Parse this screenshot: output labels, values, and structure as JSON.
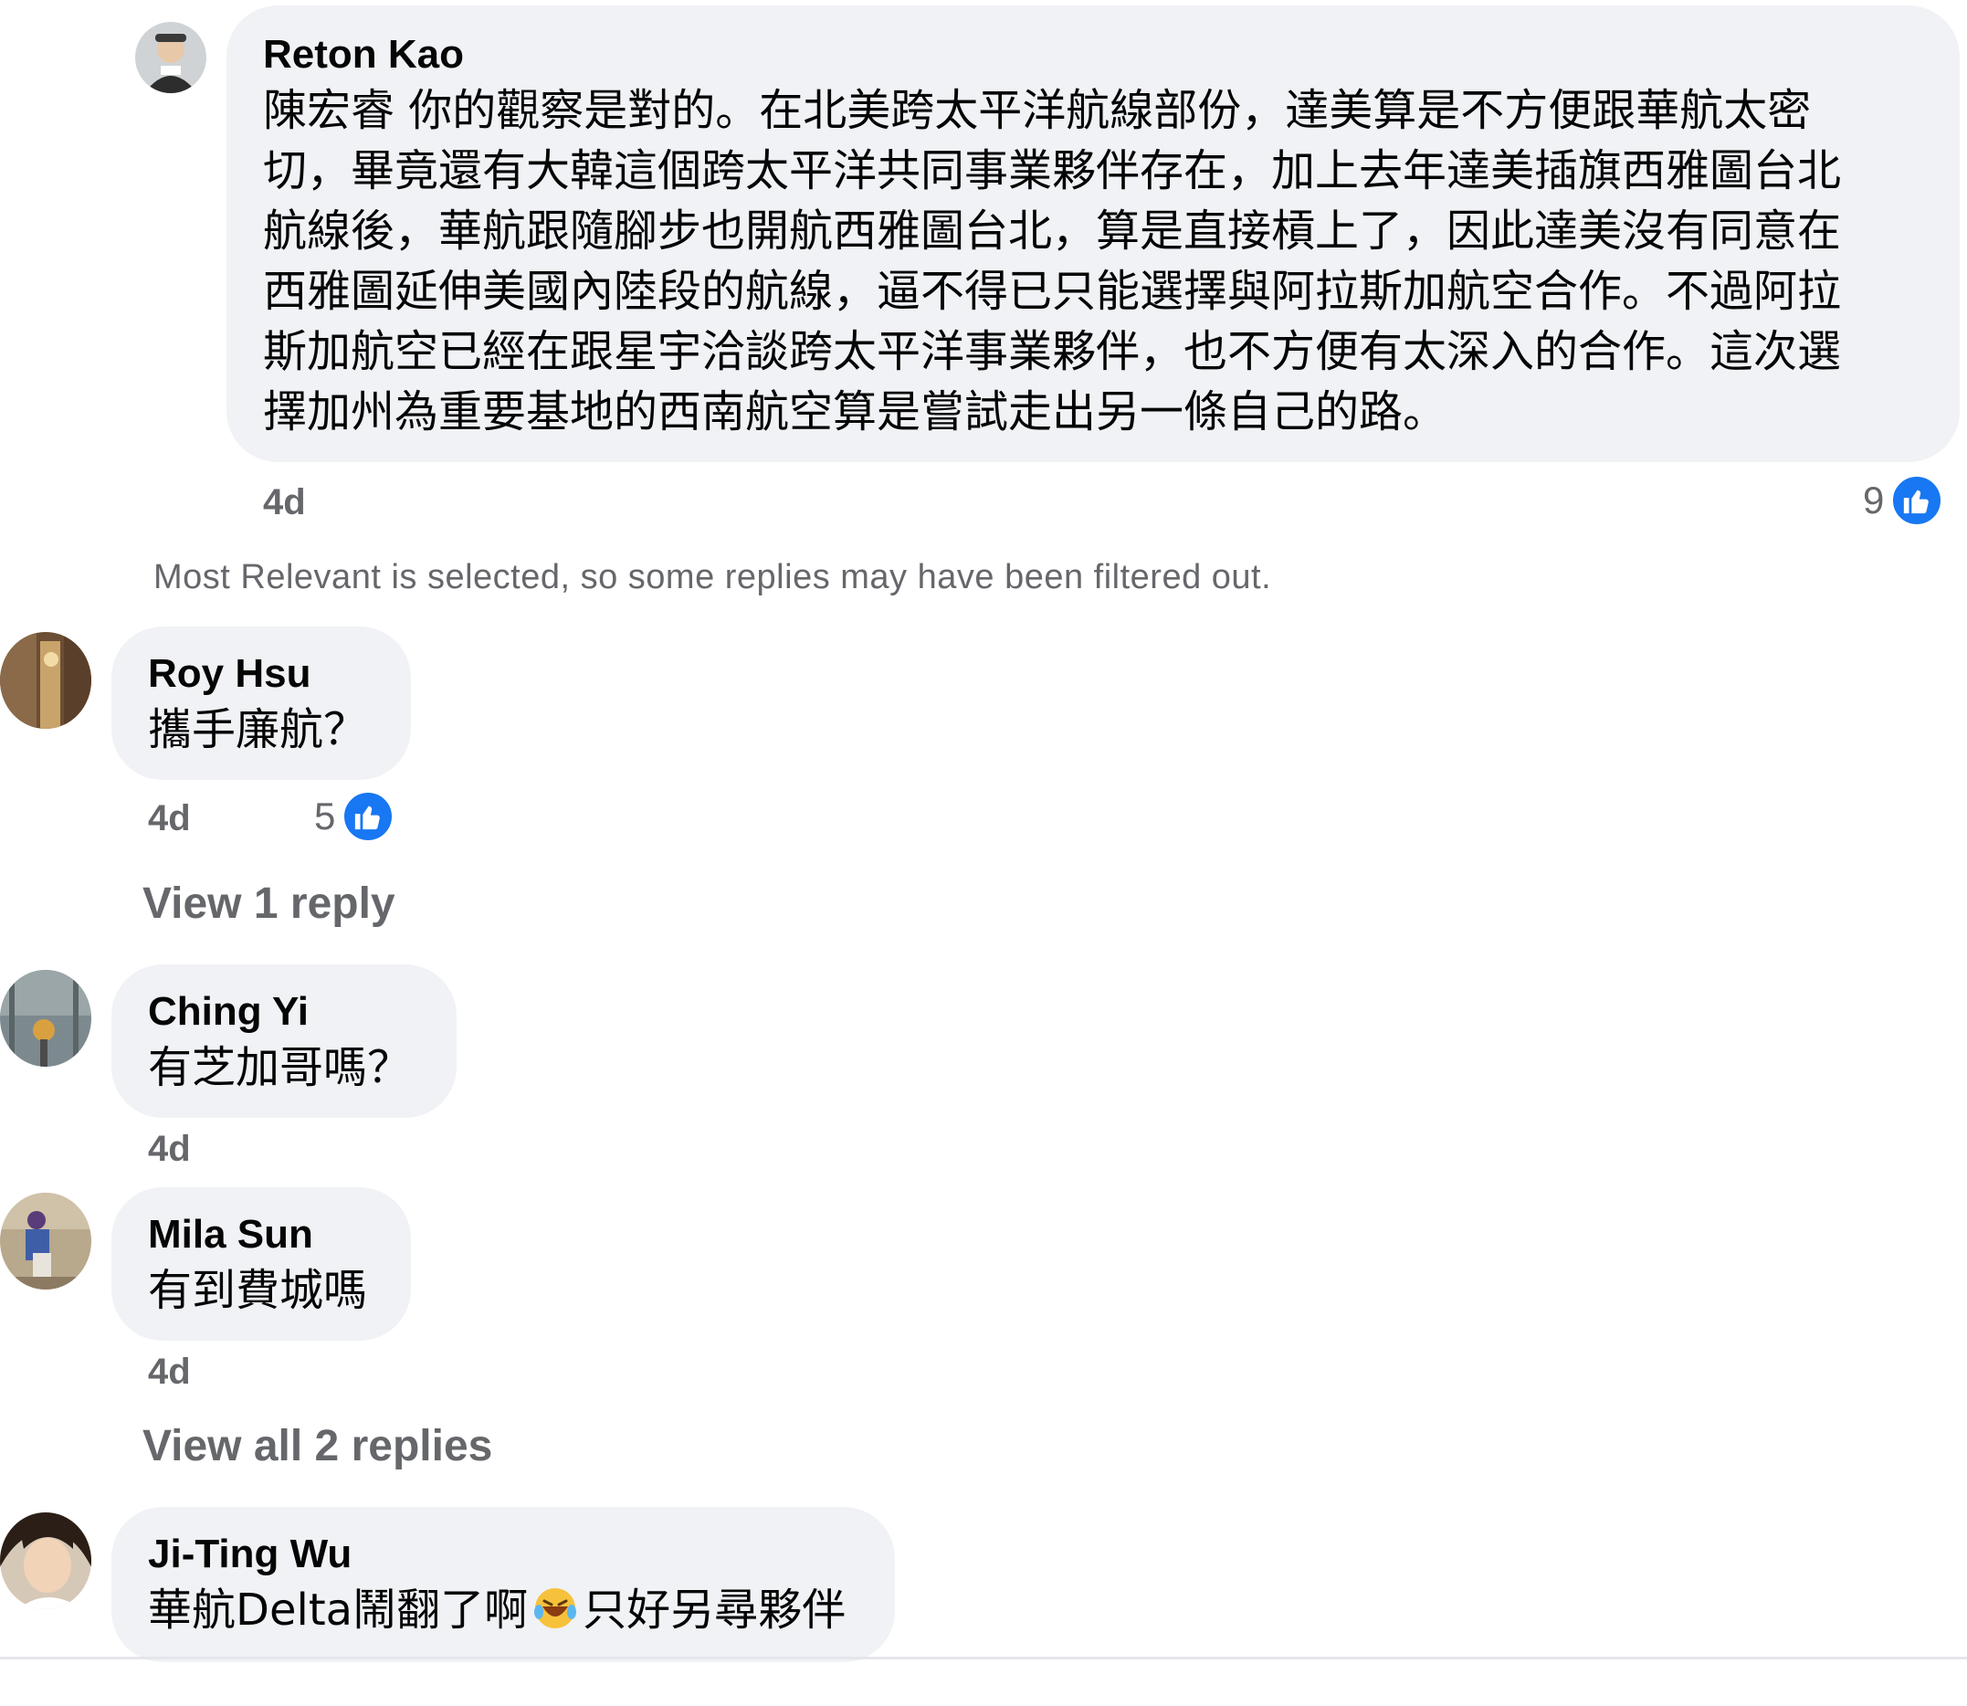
{
  "comments": [
    {
      "author": "Reton Kao",
      "text_lines": [
        "陳宏睿 你的觀察是對的。在北美跨太平洋航線部份，達美算是不方便跟華航太密",
        "切，畢竟還有大韓這個跨太平洋共同事業夥伴存在，加上去年達美插旗西雅圖台北",
        "航線後，華航跟隨腳步也開航西雅圖台北，算是直接槓上了，因此達美沒有同意在",
        "西雅圖延伸美國內陸段的航線，逼不得已只能選擇與阿拉斯加航空合作。不過阿拉",
        "斯加航空已經在跟星宇洽談跨太平洋事業夥伴，也不方便有太深入的合作。這次選",
        "擇加州為重要基地的西南航空算是嘗試走出另一條自己的路。"
      ],
      "time": "4d",
      "like_count": "9"
    },
    {
      "author": "Roy Hsu",
      "text": "攜手廉航？",
      "time": "4d",
      "like_count": "5",
      "view_replies": "View 1 reply"
    },
    {
      "author": "Ching Yi",
      "text": "有芝加哥嗎？",
      "time": "4d"
    },
    {
      "author": "Mila Sun",
      "text": "有到費城嗎",
      "time": "4d",
      "view_replies": "View all 2 replies"
    },
    {
      "author": "Ji-Ting Wu",
      "text_before_emoji": "華航Delta鬧翻了啊",
      "emoji": "rolling-on-floor-laughing",
      "text_after_emoji": "只好另尋夥伴"
    }
  ],
  "filter_note": "Most Relevant is selected, so some replies may have been filtered out.",
  "icons": {
    "like": "thumbs-up-icon",
    "like_color": "#1877f2"
  },
  "colors": {
    "bubble": "#f0f2f5",
    "meta_text": "#65676b"
  }
}
